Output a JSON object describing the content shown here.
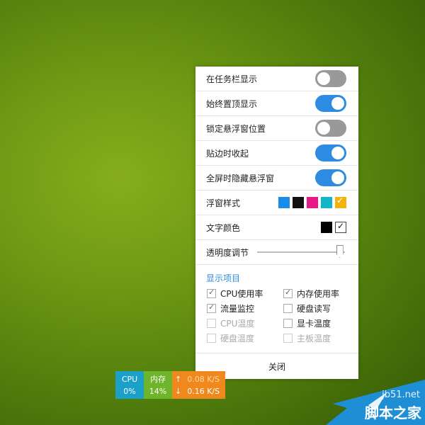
{
  "settings": {
    "rows": [
      {
        "label": "在任务栏显示",
        "state": "off"
      },
      {
        "label": "始终置顶显示",
        "state": "on"
      },
      {
        "label": "锁定悬浮窗位置",
        "state": "off"
      },
      {
        "label": "贴边时收起",
        "state": "on"
      },
      {
        "label": "全屏时隐藏悬浮窗",
        "state": "on"
      }
    ],
    "float_style": {
      "label": "浮窗样式",
      "swatches": [
        "#1a8ce8",
        "#111111",
        "#e7178a",
        "#13b5c9",
        "#f3b30f"
      ],
      "selected_index": 4
    },
    "text_color": {
      "label": "文字颜色",
      "options": [
        "#000000",
        "#ffffff"
      ],
      "selected_index": 1
    },
    "opacity": {
      "label": "透明度调节",
      "level": 0.98
    },
    "display_items": {
      "title": "显示项目",
      "items": [
        {
          "label": "CPU使用率",
          "checked": true,
          "enabled": true
        },
        {
          "label": "内存使用率",
          "checked": true,
          "enabled": true
        },
        {
          "label": "流量监控",
          "checked": true,
          "enabled": true
        },
        {
          "label": "硬盘读写",
          "checked": false,
          "enabled": true
        },
        {
          "label": "CPU温度",
          "checked": false,
          "enabled": false
        },
        {
          "label": "显卡温度",
          "checked": false,
          "enabled": true
        },
        {
          "label": "硬盘温度",
          "checked": false,
          "enabled": false
        },
        {
          "label": "主板温度",
          "checked": false,
          "enabled": false
        }
      ]
    },
    "close_label": "关闭"
  },
  "widget": {
    "cpu_label": "CPU",
    "cpu_value": "0%",
    "mem_label": "内存",
    "mem_value": "14%",
    "upload_arrow": "↑",
    "upload_value": "0.08 K/S",
    "download_arrow": "↓",
    "download_value": "0.16 K/S"
  },
  "watermark": {
    "url": "jb51.net",
    "text": "脚本之家"
  },
  "colors": {
    "accent": "#2d8be1",
    "toggle_off": "#999999"
  }
}
